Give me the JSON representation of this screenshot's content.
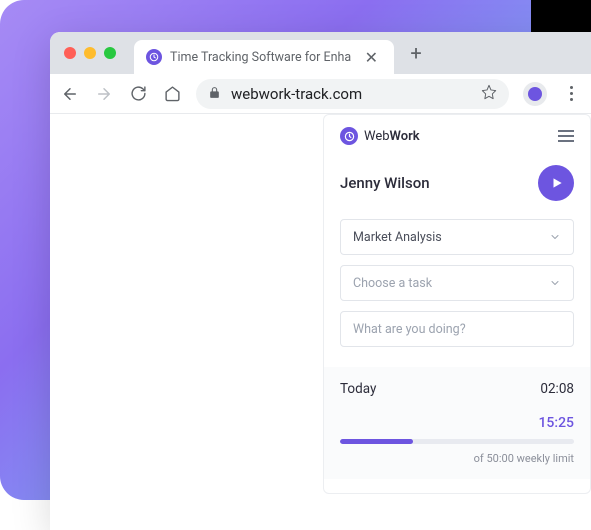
{
  "browser": {
    "tab_title": "Time Tracking Software for Enha",
    "url": "webwork-track.com"
  },
  "widget": {
    "brand_prefix": "Web",
    "brand_bold": "Work",
    "user_name": "Jenny Wilson",
    "project_selected": "Market Analysis",
    "task_placeholder": "Choose a task",
    "activity_placeholder": "What are you doing?",
    "today_label": "Today",
    "today_time": "02:08",
    "week_time": "15:25",
    "limit_text": "of 50:00 weekly limit"
  }
}
